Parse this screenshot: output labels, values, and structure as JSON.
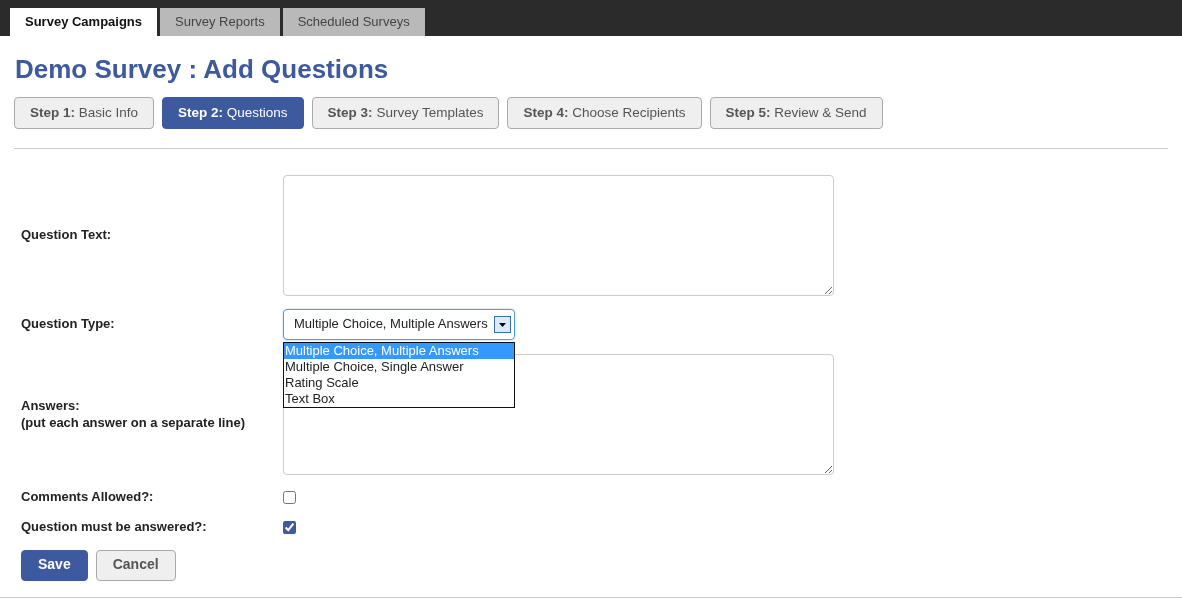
{
  "top_tabs": [
    {
      "label": "Survey Campaigns",
      "selected": true
    },
    {
      "label": "Survey Reports",
      "selected": false
    },
    {
      "label": "Scheduled Surveys",
      "selected": false
    }
  ],
  "title": "Demo Survey : Add Questions",
  "steps": [
    {
      "label": "**Step 1:** Basic Info",
      "selected": false
    },
    {
      "label": "**Step 2:** Questions",
      "selected": true
    },
    {
      "label": "**Step 3:** Survey Templates",
      "selected": false
    },
    {
      "label": "**Step 4:** Choose Recipients",
      "selected": false
    },
    {
      "label": "**Step 5:** Review & Send",
      "selected": false
    }
  ],
  "form": {
    "question_text": {
      "label": "Question Text:"
    },
    "question_type": {
      "label": "Question Type:",
      "value": "Multiple Choice, Multiple Answers",
      "expanded": true,
      "options": [
        {
          "label": "Multiple Choice, Multiple Answers",
          "selected": true
        },
        {
          "label": "Multiple Choice, Single Answer",
          "selected": false
        },
        {
          "label": "Rating Scale",
          "selected": false
        },
        {
          "label": "Text Box",
          "selected": false
        }
      ]
    },
    "answers": {
      "label": "Answers:",
      "hint": "(put each answer on a separate line)"
    },
    "checkboxes": [
      {
        "label": "Comments Allowed?:",
        "checked": false
      },
      {
        "label": "Question must be answered?:",
        "checked": true
      }
    ]
  },
  "buttons": [
    {
      "label": "Save",
      "kind": "primary"
    },
    {
      "label": "Cancel",
      "kind": "secondary"
    }
  ]
}
